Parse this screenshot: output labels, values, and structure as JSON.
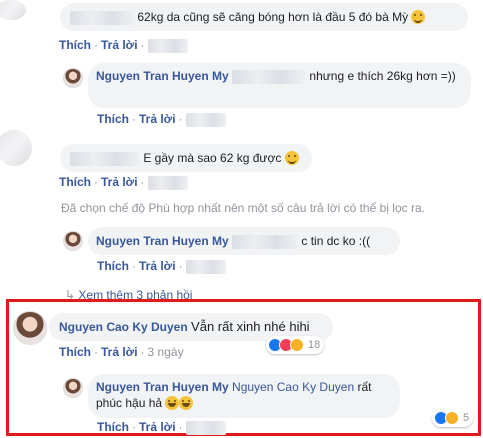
{
  "comments": {
    "c1": {
      "text": "62kg da cũng sẽ căng bóng hơn là đầu 5 đó bà Mỳ",
      "like": "Thích",
      "reply": "Trả lời"
    },
    "r1": {
      "author": "Nguyen Tran Huyen My",
      "text": "nhưng e thích 26kg hơn =))",
      "like": "Thích",
      "reply": "Trả lời"
    },
    "c2": {
      "text": "E gầy mà sao 62 kg được",
      "like": "Thích",
      "reply": "Trả lời"
    },
    "notice": "Đã chọn chế độ Phù hợp nhất nên một số câu trả lời có thể bị lọc ra.",
    "r2": {
      "author": "Nguyen Tran Huyen My",
      "text": "c tin dc ko :((",
      "like": "Thích",
      "reply": "Trả lời"
    },
    "see_more": "Xem thêm 3 phản hồi",
    "c3": {
      "author": "Nguyen Cao Ky Duyen",
      "text": "Vẫn rất xinh nhé hihi",
      "like": "Thích",
      "reply": "Trả lời",
      "time": "3 ngày",
      "reaction_count": "18"
    },
    "r3": {
      "author": "Nguyen Tran Huyen My",
      "mention": "Nguyen Cao Ky Duyen",
      "text": "rất phúc hậu hả",
      "like": "Thích",
      "reply": "Trả lời",
      "reaction_count": "5"
    }
  },
  "colors": {
    "link": "#385898",
    "bubble": "#f2f3f5",
    "meta": "#90949c",
    "highlight_border": "#e11a1a"
  }
}
